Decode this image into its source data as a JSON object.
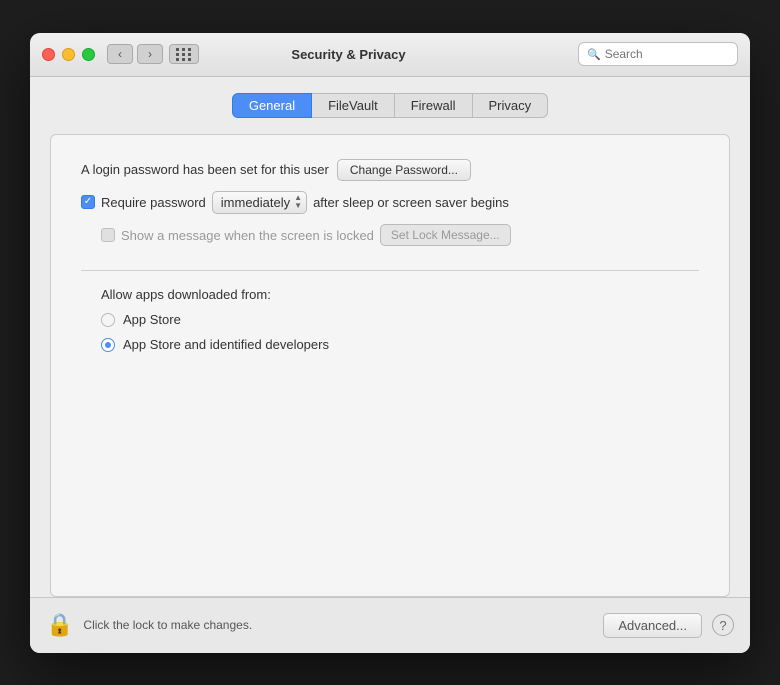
{
  "window": {
    "title": "Security & Privacy"
  },
  "titlebar": {
    "back_label": "‹",
    "forward_label": "›"
  },
  "search": {
    "placeholder": "Search",
    "value": ""
  },
  "tabs": [
    {
      "id": "general",
      "label": "General",
      "active": true
    },
    {
      "id": "filevault",
      "label": "FileVault",
      "active": false
    },
    {
      "id": "firewall",
      "label": "Firewall",
      "active": false
    },
    {
      "id": "privacy",
      "label": "Privacy",
      "active": false
    }
  ],
  "general": {
    "login_password_text": "A login password has been set for this user",
    "change_password_label": "Change Password...",
    "require_password_label": "Require password",
    "require_password_checked": true,
    "dropdown_value": "immediately",
    "after_sleep_text": "after sleep or screen saver begins",
    "show_message_label": "Show a message when the screen is locked",
    "show_message_checked": false,
    "set_lock_message_label": "Set Lock Message...",
    "allow_apps_label": "Allow apps downloaded from:",
    "app_store_label": "App Store",
    "app_store_selected": false,
    "app_store_identified_label": "App Store and identified developers",
    "app_store_identified_selected": true
  },
  "bottom": {
    "lock_text": "Click the lock to make changes.",
    "advanced_label": "Advanced...",
    "help_label": "?"
  }
}
